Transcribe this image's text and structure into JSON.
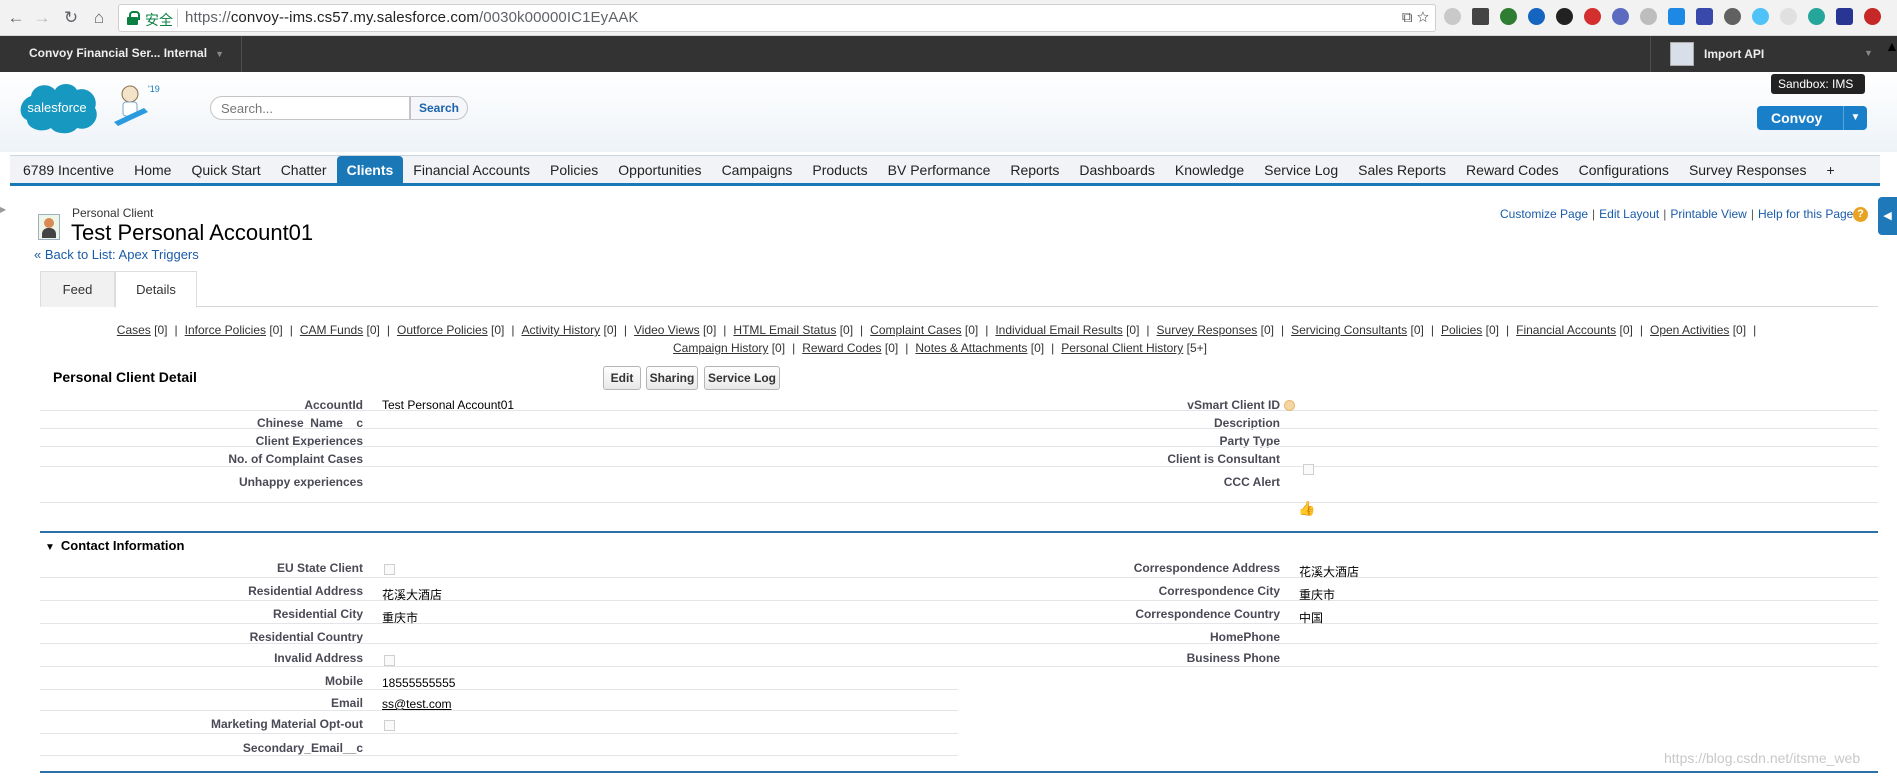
{
  "browser": {
    "secure_label": "安全",
    "url_prefix": "https://",
    "url_host": "convoy--ims.cs57.my.salesforce.com",
    "url_path": "/0030k00000IC1EyAAK"
  },
  "topbar": {
    "app_name": "Convoy Financial Ser... Internal",
    "user_name": "Import API"
  },
  "header": {
    "logo_text": "salesforce",
    "search_placeholder": "Search...",
    "search_button": "Search",
    "sandbox_label": "Sandbox:  IMS",
    "org_button": "Convoy"
  },
  "tabs": [
    {
      "label": "6789 Incentive"
    },
    {
      "label": "Home"
    },
    {
      "label": "Quick Start"
    },
    {
      "label": "Chatter"
    },
    {
      "label": "Clients"
    },
    {
      "label": "Financial Accounts"
    },
    {
      "label": "Policies"
    },
    {
      "label": "Opportunities"
    },
    {
      "label": "Campaigns"
    },
    {
      "label": "Products"
    },
    {
      "label": "BV Performance"
    },
    {
      "label": "Reports"
    },
    {
      "label": "Dashboards"
    },
    {
      "label": "Knowledge"
    },
    {
      "label": "Service Log"
    },
    {
      "label": "Sales Reports"
    },
    {
      "label": "Reward Codes"
    },
    {
      "label": "Configurations"
    },
    {
      "label": "Survey Responses"
    },
    {
      "label": "+"
    }
  ],
  "record": {
    "type": "Personal Client",
    "name": "Test Personal Account01",
    "back_link": "« Back to List: Apex Triggers"
  },
  "help_links": {
    "customize": "Customize Page",
    "edit_layout": "Edit Layout",
    "printable": "Printable View",
    "help": "Help for this Page"
  },
  "detail_tabs": {
    "feed": "Feed",
    "details": "Details"
  },
  "related_row1": [
    {
      "label": "Cases",
      "count": "[0]"
    },
    {
      "label": "Inforce Policies",
      "count": "[0]"
    },
    {
      "label": "CAM Funds",
      "count": "[0]"
    },
    {
      "label": "Outforce Policies",
      "count": "[0]"
    },
    {
      "label": "Activity History",
      "count": "[0]"
    },
    {
      "label": "Video Views",
      "count": "[0]"
    },
    {
      "label": "HTML Email Status",
      "count": "[0]"
    },
    {
      "label": "Complaint Cases",
      "count": "[0]"
    },
    {
      "label": "Individual Email Results",
      "count": "[0]"
    },
    {
      "label": "Survey Responses",
      "count": "[0]"
    },
    {
      "label": "Servicing Consultants",
      "count": "[0]"
    },
    {
      "label": "Policies",
      "count": "[0]"
    },
    {
      "label": "Financial Accounts",
      "count": "[0]"
    },
    {
      "label": "Open Activities",
      "count": "[0]"
    }
  ],
  "related_row2": [
    {
      "label": "Campaign History",
      "count": "[0]"
    },
    {
      "label": "Reward Codes",
      "count": "[0]"
    },
    {
      "label": "Notes & Attachments",
      "count": "[0]"
    },
    {
      "label": "Personal Client History",
      "count": "[5+]"
    }
  ],
  "detail": {
    "title": "Personal Client Detail",
    "edit": "Edit",
    "sharing": "Sharing",
    "service_log": "Service Log",
    "left_labels": [
      "AccountId",
      "Chinese_Name__c",
      "Client Experiences",
      "No. of Complaint Cases",
      "Unhappy experiences"
    ],
    "account_id_value": "Test Personal Account01",
    "right_labels": [
      "vSmart Client ID",
      "Description",
      "Party Type",
      "Client is Consultant",
      "CCC Alert"
    ]
  },
  "contact": {
    "title": "Contact Information",
    "left_labels": [
      "EU State Client",
      "Residential Address",
      "Residential City",
      "Residential Country",
      "Invalid Address",
      "Mobile",
      "Email",
      "Marketing Material Opt-out",
      "Secondary_Email__c"
    ],
    "residential_address": "花溪大酒店",
    "residential_city": "重庆市",
    "mobile": "18555555555",
    "email": "ss@test.com",
    "right_labels": [
      "Correspondence Address",
      "Correspondence City",
      "Correspondence Country",
      "HomePhone",
      "Business Phone"
    ],
    "correspondence_address": "花溪大酒店",
    "correspondence_city": "重庆市",
    "correspondence_country": "中国"
  },
  "watermark": "https://blog.csdn.net/itsme_web"
}
